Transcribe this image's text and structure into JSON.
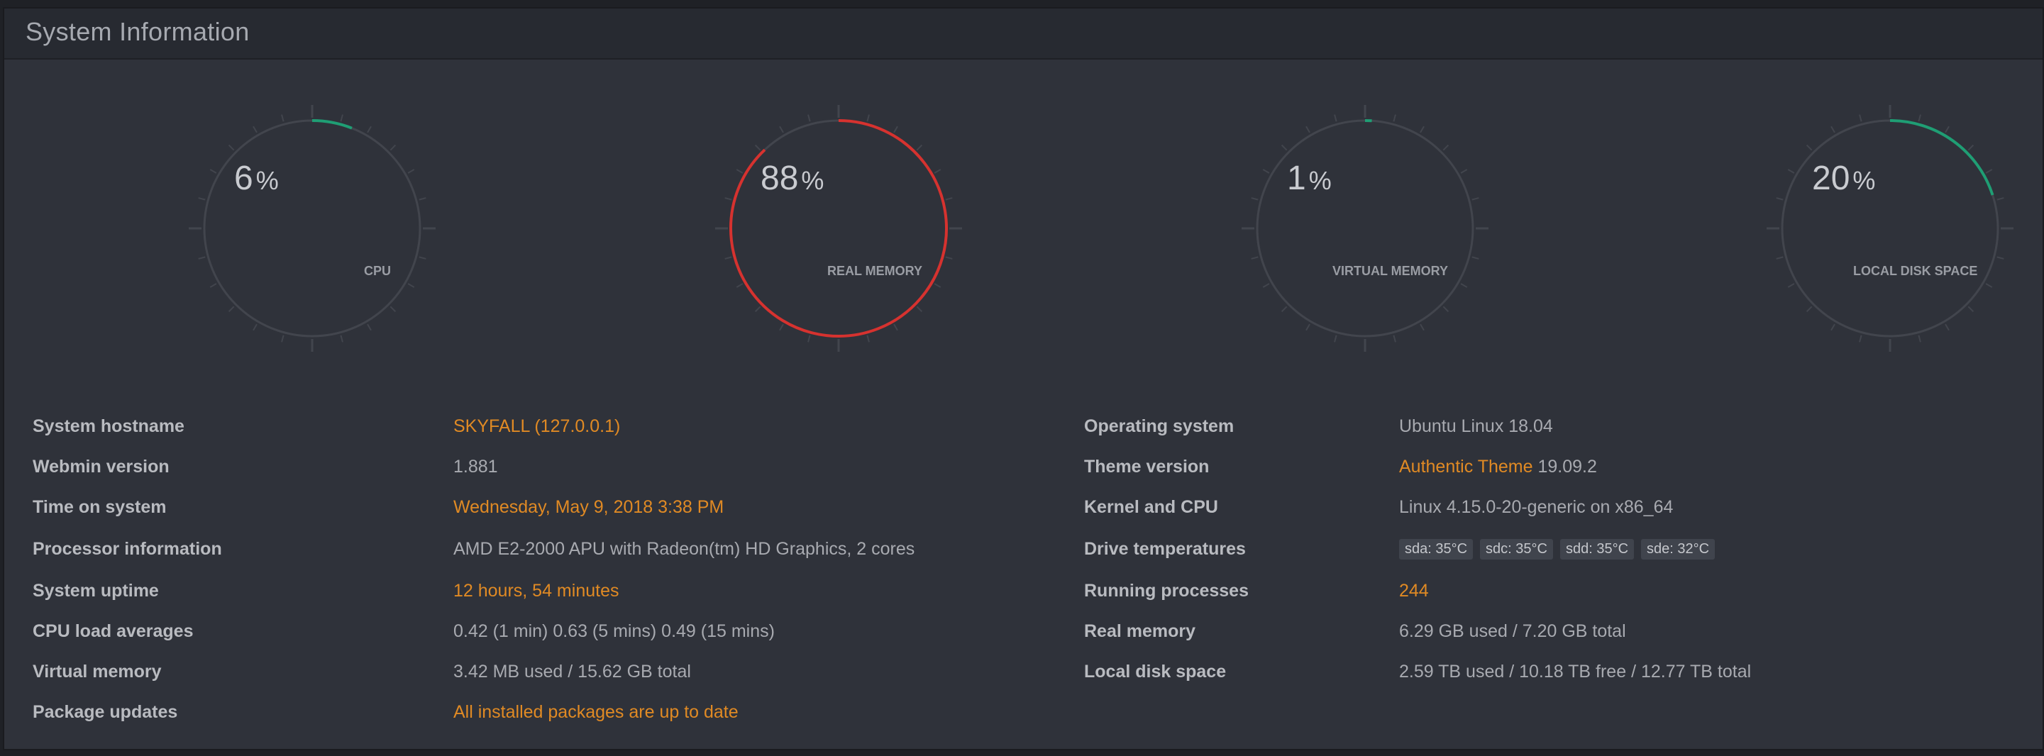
{
  "panel": {
    "title": "System Information"
  },
  "colors": {
    "track": "#42454d",
    "green_arc": "#1f9e74",
    "red_arc": "#d6322f",
    "link_orange": "#e08a24"
  },
  "gauges": [
    {
      "id": "cpu",
      "value": 6,
      "percent_sign": "%",
      "label": "CPU",
      "color": "#1f9e74"
    },
    {
      "id": "real-memory",
      "value": 88,
      "percent_sign": "%",
      "label": "REAL MEMORY",
      "color": "#d6322f"
    },
    {
      "id": "virtual-memory",
      "value": 1,
      "percent_sign": "%",
      "label": "VIRTUAL MEMORY",
      "color": "#1f9e74"
    },
    {
      "id": "local-disk-space",
      "value": 20,
      "percent_sign": "%",
      "label": "LOCAL DISK SPACE",
      "color": "#1f9e74"
    }
  ],
  "left_info": [
    {
      "key": "System hostname",
      "value": "SKYFALL (127.0.0.1)",
      "link": true
    },
    {
      "key": "Webmin version",
      "value": "1.881",
      "link": false
    },
    {
      "key": "Time on system",
      "value": "Wednesday, May 9, 2018 3:38 PM",
      "link": true
    },
    {
      "key": "Processor information",
      "value": "AMD E2-2000 APU with Radeon(tm) HD Graphics, 2 cores",
      "link": false
    },
    {
      "key": "System uptime",
      "value": "12 hours, 54 minutes",
      "link": true
    },
    {
      "key": "CPU load averages",
      "value": "0.42 (1 min) 0.63 (5 mins) 0.49 (15 mins)",
      "link": false
    },
    {
      "key": "Virtual memory",
      "value": "3.42 MB used / 15.62 GB total",
      "link": false
    },
    {
      "key": "Package updates",
      "value": "All installed packages are up to date",
      "link": true
    }
  ],
  "right_info": {
    "operating_system": {
      "key": "Operating system",
      "value": "Ubuntu Linux 18.04"
    },
    "theme_version": {
      "key": "Theme version",
      "link_text": "Authentic Theme",
      "version": "19.09.2"
    },
    "kernel": {
      "key": "Kernel and CPU",
      "value": "Linux 4.15.0-20-generic on x86_64"
    },
    "drive_temps": {
      "key": "Drive temperatures",
      "badges": [
        "sda: 35°C",
        "sdc: 35°C",
        "sdd: 35°C",
        "sde: 32°C"
      ]
    },
    "processes": {
      "key": "Running processes",
      "value": "244"
    },
    "real_memory": {
      "key": "Real memory",
      "value": "6.29 GB used / 7.20 GB total"
    },
    "disk_space": {
      "key": "Local disk space",
      "value": "2.59 TB used / 10.18 TB free / 12.77 TB total"
    }
  }
}
